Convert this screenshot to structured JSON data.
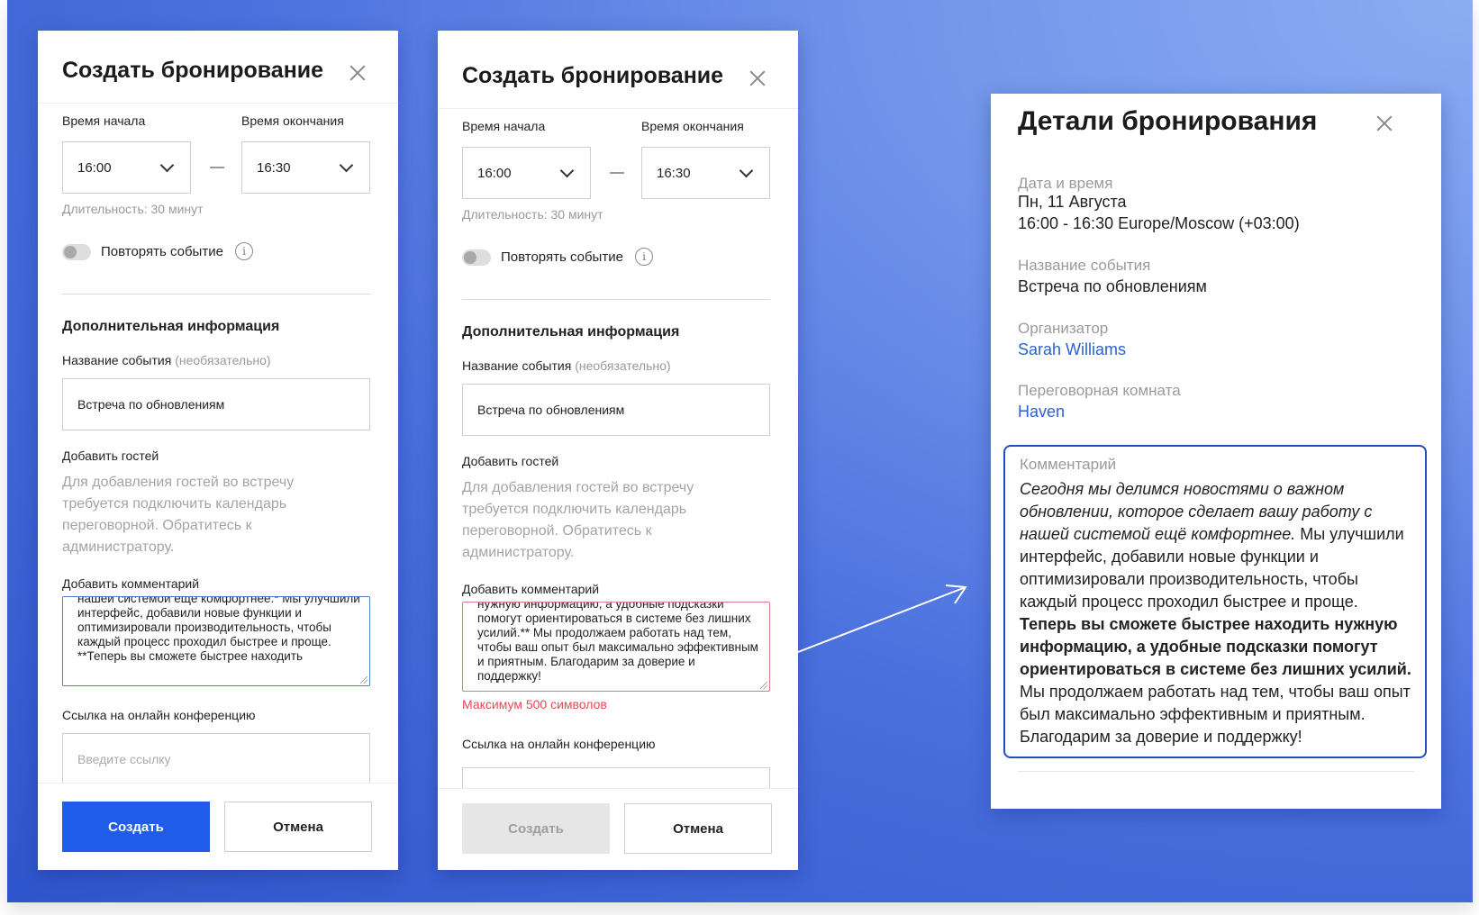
{
  "form_left": {
    "title": "Создать бронирование",
    "start_label": "Время начала",
    "end_label": "Время окончания",
    "start_value": "16:00",
    "end_value": "16:30",
    "duration": "Длительность: 30 минут",
    "repeat_label": "Повторять событие",
    "section_title": "Дополнительная информация",
    "event_name_label": "Название события",
    "optional": "(необязательно)",
    "event_name_value": "Встреча по обновлениям",
    "guests_label": "Добавить гостей",
    "guests_help": "Для добавления гостей во встречу требуется подключить календарь переговорной. Обратитесь к администратору.",
    "comment_label": "Добавить комментарий",
    "comment_text": "нашей системой ещё комфортнее.* Мы улучшили интерфейс, добавили новые функции и оптимизировали производительность, чтобы каждый процесс проходил быстрее и проще. **Теперь вы сможете быстрее находить",
    "link_label": "Ссылка на онлайн конференцию",
    "link_placeholder": "Введите ссылку",
    "create_button": "Создать",
    "cancel_button": "Отмена"
  },
  "form_right": {
    "title": "Создать бронирование",
    "start_label": "Время начала",
    "end_label": "Время окончания",
    "start_value": "16:00",
    "end_value": "16:30",
    "duration": "Длительность: 30 минут",
    "repeat_label": "Повторять событие",
    "section_title": "Дополнительная информация",
    "event_name_label": "Название события",
    "optional": "(необязательно)",
    "event_name_value": "Встреча по обновлениям",
    "guests_label": "Добавить гостей",
    "guests_help": "Для добавления гостей во встречу требуется подключить календарь переговорной. Обратитесь к администратору.",
    "comment_label": "Добавить комментарий",
    "comment_text": "нужную информацию, а удобные подсказки помогут ориентироваться в системе без лишних усилий.** Мы продолжаем работать над тем, чтобы ваш опыт был максимально эффективным и приятным. Благодарим за доверие и поддержку!",
    "error": "Максимум 500 символов",
    "link_label": "Ссылка на онлайн конференцию",
    "create_button": "Создать",
    "cancel_button": "Отмена"
  },
  "details": {
    "title": "Детали бронирования",
    "date_label": "Дата и время",
    "date_value": "Пн, 11 Августа",
    "time_value": "16:00 - 16:30 Europe/Moscow (+03:00)",
    "event_label": "Название события",
    "event_value": "Встреча по обновлениям",
    "organizer_label": "Организатор",
    "organizer_value": "Sarah Williams",
    "room_label": "Переговорная комната",
    "room_value": "Haven",
    "comment_label": "Комментарий",
    "comment_italic": "Сегодня мы делимся новостями о важном обновлении, которое сделает вашу работу с нашей системой ещё комфортнее.",
    "comment_normal1": " Мы улучшили интерфейс, добавили новые функции и оптимизировали производительность, чтобы каждый процесс проходил быстрее и проще. ",
    "comment_bold": "Теперь вы сможете быстрее находить нужную информацию, а удобные подсказки помогут ориентироваться в системе без лишних усилий.",
    "comment_normal2": " Мы продолжаем работать над тем, чтобы ваш опыт был максимально эффективным и приятным. Благодарим за доверие и поддержку!"
  },
  "colors": {
    "primary": "#1f5ce8",
    "link": "#2a62d6",
    "error": "#e04b57",
    "focus_border": "#1f4fb8"
  }
}
